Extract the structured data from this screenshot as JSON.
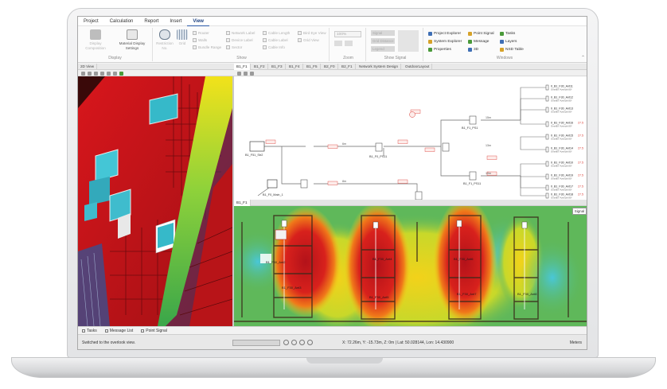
{
  "menu": [
    "Project",
    "Calculation",
    "Report",
    "Insert",
    "View"
  ],
  "menu_active": "View",
  "ribbon": {
    "display_group": {
      "label": "Display",
      "buttons": [
        {
          "label": "Display\nComposition",
          "dim": true
        },
        {
          "label": "Material Display\nSettings",
          "dim": false
        }
      ]
    },
    "show_group": {
      "label": "Show",
      "buttons": [
        {
          "label": "Restriction\nNo."
        },
        {
          "label": "Grid"
        }
      ],
      "checkboxes_col1": [
        "Router",
        "Walls",
        "Bundle Range"
      ],
      "checkboxes_col2": [
        "Network Label",
        "Device Label",
        "Sector"
      ],
      "checkboxes_col3": [
        "Cable Length",
        "Cable Label",
        "Cable Info"
      ],
      "checkboxes_col4": [
        "Bird Eye View",
        "Grid View"
      ]
    },
    "zoom_group": {
      "label": "Zoom",
      "value": "100%"
    },
    "show_signal_group": {
      "label": "Show Signal",
      "items": [
        "Signal",
        "Grid Distance",
        "Legend"
      ]
    },
    "windows_group": {
      "label": "Windows",
      "col1": [
        "Project Explorer",
        "System Explorer",
        "Properties"
      ],
      "col2": [
        "Point Signal",
        "Message",
        "3D"
      ],
      "col3": [
        "Tasks",
        "Layers",
        "NSD Table"
      ]
    }
  },
  "tabs": [
    "2D View",
    "B1_F1",
    "B1_F2",
    "B1_F3",
    "B1_F4",
    "B1_F5",
    "B2_F0",
    "B2_F1",
    "Network System Design",
    "OutdoorLayout"
  ],
  "active_tab": "B1_F1",
  "heatmap_tab": "B1_F1",
  "diagram": {
    "nodes": [
      "B1_F51_Str2",
      "B1_F0_Main_1",
      "B1_F0_PS11",
      "B1_F1_PS1",
      "B1_F1_PS11"
    ],
    "antennas": [
      {
        "name": "0_B1_F30_Ant11",
        "sub": "Omni80° Azimuth:90°",
        "val": ""
      },
      {
        "name": "0_B1_F30_Ant12",
        "sub": "Omni80° Azimuth:90°",
        "val": ""
      },
      {
        "name": "0_B1_F30_Ant13",
        "sub": "Omni80° Azimuth:90°",
        "val": ""
      },
      {
        "name": "0_B1_F30_Ant16",
        "sub": "Omni80° Azimuth:90°",
        "val": "27.5"
      },
      {
        "name": "0_B1_F30_Ant15",
        "sub": "Omni80° Azimuth:90°",
        "val": "27.5"
      },
      {
        "name": "0_B1_F30_Ant14",
        "sub": "Omni80° Azimuth:90°",
        "val": "27.5"
      },
      {
        "name": "0_B1_F30_Ant10",
        "sub": "Omni80° Azimuth:90°",
        "val": "27.5"
      },
      {
        "name": "0_B1_F30_Ant19",
        "sub": "Omni80° Azimuth:90°",
        "val": "27.5"
      },
      {
        "name": "0_B1_F30_Ant17",
        "sub": "Omni80° Azimuth:90°",
        "val": "27.5"
      },
      {
        "name": "0_B1_F30_Ant18",
        "sub": "Omni80° Azimuth:90°",
        "val": "27.5"
      }
    ],
    "cable_labels": [
      "6m",
      "8m",
      "15m",
      "10m",
      "13m"
    ]
  },
  "heatmap_labels": [
    "B1_F30_Ant2",
    "B1_F30_Ant3",
    "B1_F30_Ant4",
    "B1_F30_Ant5",
    "B1_F30_Ant6",
    "B1_F30_Ant7",
    "B1_F30_Ant8"
  ],
  "heatmap_badge": "Signal",
  "bottom_tabs": [
    "Tasks",
    "Message List",
    "Point Signal"
  ],
  "status": {
    "message": "Switched to the overlook view.",
    "coords": "X: 72.26m, Y: -15.73m, Z: 0m | Lat: 50.028144, Lon: 14.430900",
    "units": "Meters"
  },
  "colors": {
    "accent": "#2b5aa8",
    "heat_red": "#c0141a",
    "heat_yellow": "#f2d21a",
    "heat_green": "#5fb85a",
    "heat_cyan": "#44c6d6",
    "diagram_red": "#d9362f"
  }
}
